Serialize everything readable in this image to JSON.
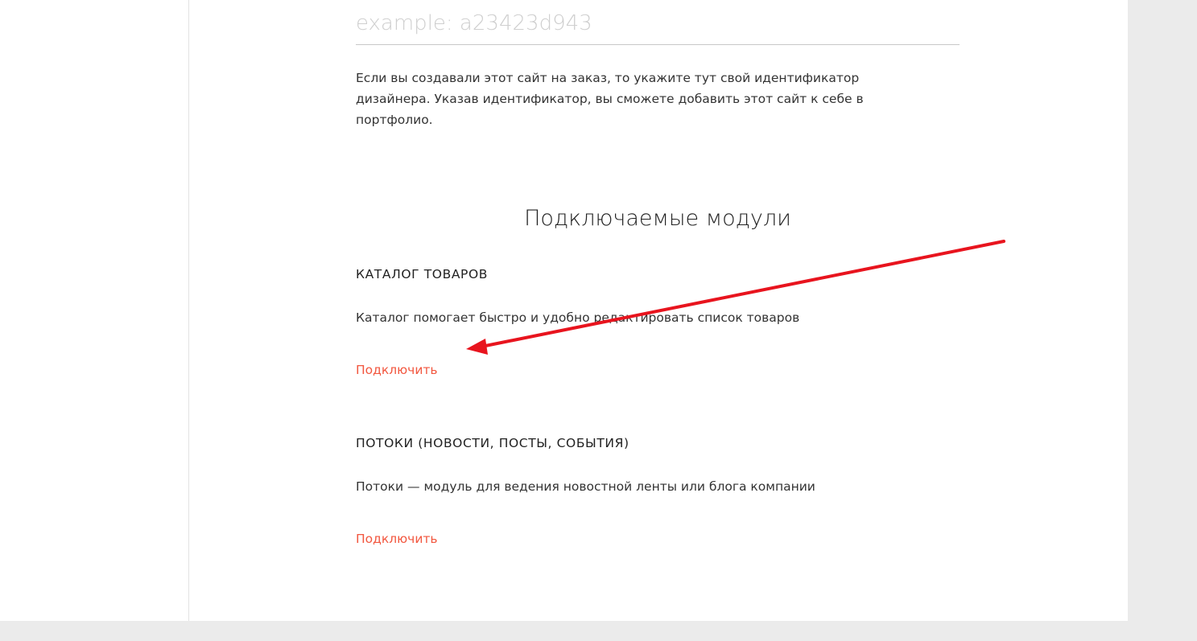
{
  "designer_id": {
    "placeholder": "example: a23423d943",
    "value": "",
    "hint": "Если вы создавали этот сайт на заказ, то укажите тут свой идентификатор дизайнера. Указав идентификатор, вы сможете добавить этот сайт к себе в портфолио."
  },
  "modules_section": {
    "title": "Подключаемые модули",
    "modules": [
      {
        "title": "КАТАЛОГ ТОВАРОВ",
        "description": "Каталог помогает быстро и удобно редактировать список товаров",
        "action_label": "Подключить"
      },
      {
        "title": "ПОТОКИ (НОВОСТИ, ПОСТЫ, СОБЫТИЯ)",
        "description": "Потоки — модуль для ведения новостной ленты или блога компании",
        "action_label": "Подключить"
      }
    ]
  },
  "colors": {
    "accent_link": "#f2573f",
    "annotation_arrow": "#e8141e",
    "page_background": "#ebebeb",
    "panel_background": "#ffffff"
  },
  "annotation": {
    "icon": "red-arrow-annotation"
  }
}
